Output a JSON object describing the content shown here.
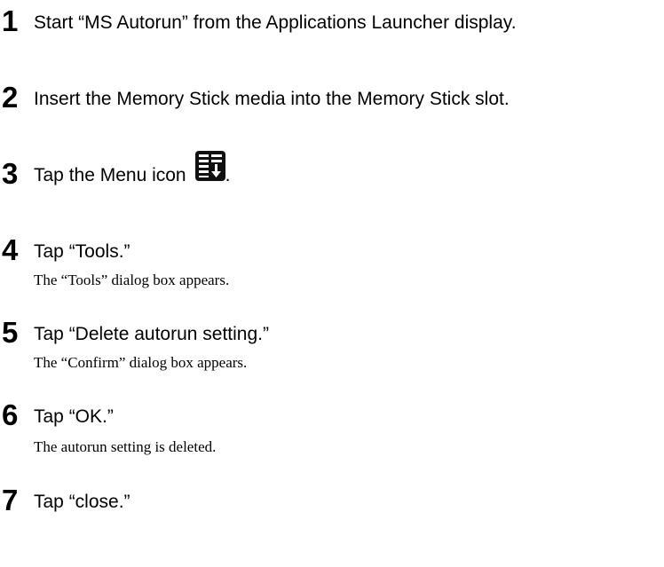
{
  "steps": [
    {
      "number": "1",
      "instruction": "Start “MS Autorun” from the Applications Launcher display.",
      "description": ""
    },
    {
      "number": "2",
      "instruction": "Insert the Memory Stick media into the Memory Stick slot.",
      "description": ""
    },
    {
      "number": "3",
      "instruction": "Tap the Menu icon",
      "suffix": ".",
      "icon": "menu-icon",
      "description": ""
    },
    {
      "number": "4",
      "instruction": "Tap “Tools.”",
      "description": "The “Tools” dialog box appears."
    },
    {
      "number": "5",
      "instruction": "Tap “Delete autorun setting.”",
      "description": "The “Confirm” dialog box appears."
    },
    {
      "number": "6",
      "instruction": "Tap “OK.”",
      "description": "The autorun setting is deleted."
    },
    {
      "number": "7",
      "instruction": "Tap “close.”",
      "description": ""
    }
  ]
}
